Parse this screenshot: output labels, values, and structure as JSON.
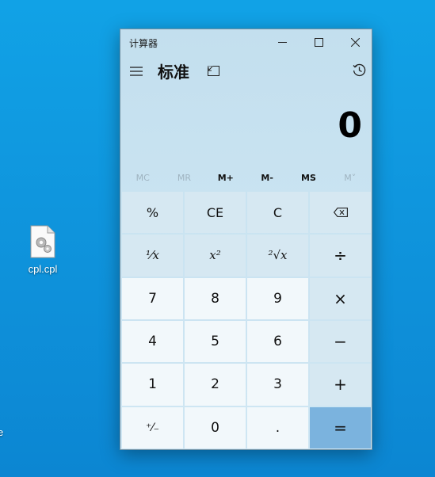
{
  "desktop": {
    "icon_label": "cpl.cpl",
    "cut_label": "e"
  },
  "window": {
    "title": "计算器",
    "mode_title": "标准",
    "display_value": "0"
  },
  "memory": {
    "buttons": [
      {
        "label": "MC",
        "enabled": false
      },
      {
        "label": "MR",
        "enabled": false
      },
      {
        "label": "M+",
        "enabled": true
      },
      {
        "label": "M-",
        "enabled": true
      },
      {
        "label": "MS",
        "enabled": true
      },
      {
        "label": "M˅",
        "enabled": false
      }
    ]
  },
  "keys": {
    "percent": "%",
    "ce": "CE",
    "c": "C",
    "reciprocal": "¹⁄x",
    "square": "x²",
    "sqrt": "²√x",
    "divide": "÷",
    "seven": "7",
    "eight": "8",
    "nine": "9",
    "multiply": "×",
    "four": "4",
    "five": "5",
    "six": "6",
    "minus": "−",
    "one": "1",
    "two": "2",
    "three": "3",
    "plus": "+",
    "negate": "⁺⁄₋",
    "zero": "0",
    "decimal": ".",
    "equals": "="
  },
  "colors": {
    "desktop_bg": "#0f95dd",
    "window_bg": "#c9e3f1",
    "digit_key_bg": "#f2f8fb",
    "op_key_bg": "#d6e8f2",
    "equals_bg": "#7bb3de"
  },
  "icons": {
    "file": "cpl-file-icon",
    "minimize": "minimize-icon",
    "maximize": "maximize-icon",
    "close": "close-icon",
    "menu": "hamburger-menu-icon",
    "keep_on_top": "keep-on-top-icon",
    "history": "history-icon",
    "backspace": "backspace-icon"
  }
}
